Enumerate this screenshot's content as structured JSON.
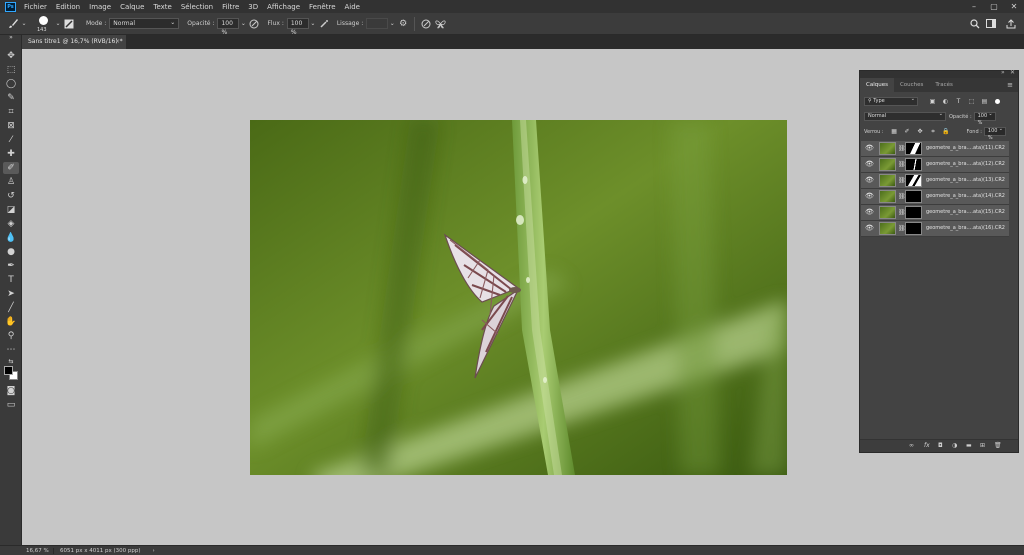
{
  "menubar": {
    "items": [
      "Fichier",
      "Edition",
      "Image",
      "Calque",
      "Texte",
      "Sélection",
      "Filtre",
      "3D",
      "Affichage",
      "Fenêtre",
      "Aide"
    ],
    "app_icon": "Ps"
  },
  "options": {
    "brush_size": "143",
    "mode_label": "Mode :",
    "mode_value": "Normal",
    "opacity_label": "Opacité :",
    "opacity_value": "100 %",
    "flow_label": "Flux :",
    "flow_value": "100 %",
    "smoothing_label": "Lissage :",
    "smoothing_value": ""
  },
  "document": {
    "tab_title": "Sans titre1 @ 16,7% (RVB/16) *",
    "close": "×"
  },
  "status": {
    "zoom": "16,67 %",
    "dimensions": "6051 px x 4011 px (300 ppp)",
    "arrow": "›"
  },
  "panel": {
    "tabs": [
      "Calques",
      "Couches",
      "Tracés"
    ],
    "filter_kind": "Type",
    "blend_mode": "Normal",
    "opacity_label": "Opacité :",
    "opacity_value": "100 %",
    "lock_label": "Verrou :",
    "fill_label": "Fond :",
    "fill_value": "100 %",
    "layers": [
      {
        "name": "geometre_a_bra....ata)(11).CR2"
      },
      {
        "name": "geometre_a_bra....ata)(12).CR2"
      },
      {
        "name": "geometre_a_bra....ata)(13).CR2"
      },
      {
        "name": "geometre_a_bra....ata)(14).CR2"
      },
      {
        "name": "geometre_a_bra....ata)(15).CR2"
      },
      {
        "name": "geometre_a_bra....ata)(16).CR2"
      }
    ]
  },
  "colors": {
    "accent": "#31a8ff",
    "canvas_bg": "#c6c6c6",
    "ui_dark": "#323232"
  }
}
